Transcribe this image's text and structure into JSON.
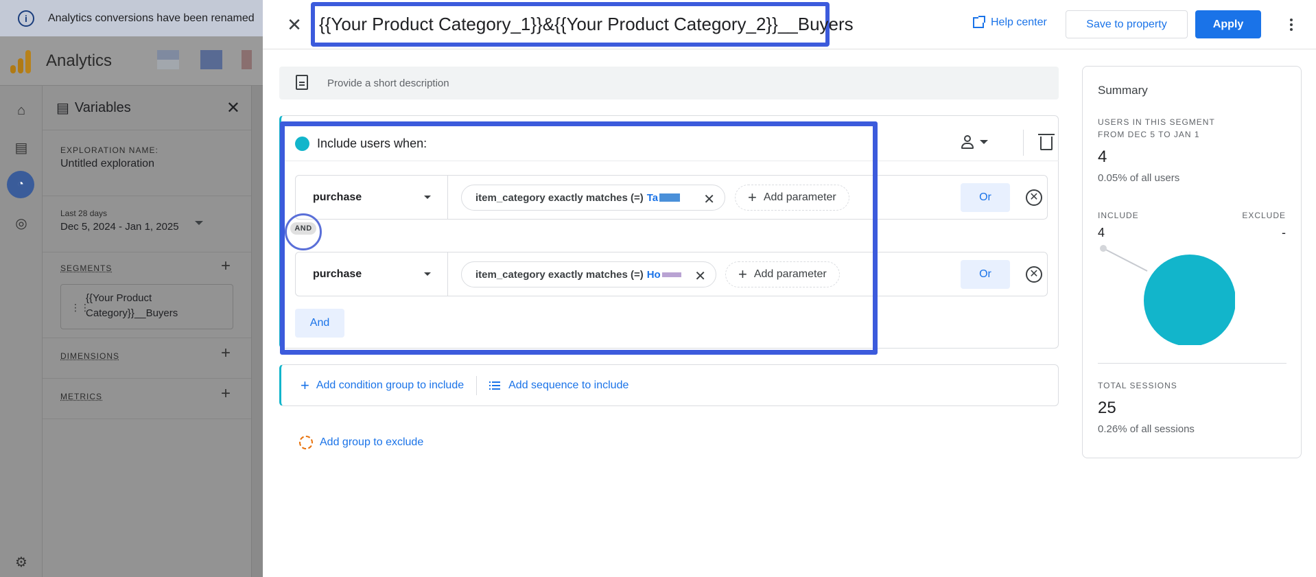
{
  "banner": {
    "text": "Analytics conversions have been renamed"
  },
  "app": {
    "name": "Analytics"
  },
  "variables": {
    "title": "Variables",
    "exploration_label": "EXPLORATION NAME:",
    "exploration_name": "Untitled exploration",
    "date_label": "Last 28 days",
    "date_range": "Dec 5, 2024 - Jan 1, 2025",
    "segments_label": "SEGMENTS",
    "segment_name": "{{Your Product Category}}__Buyers",
    "dimensions_label": "DIMENSIONS",
    "metrics_label": "METRICS"
  },
  "dialog": {
    "title": "{{Your Product Category_1}}&{{Your Product Category_2}}__Buyers",
    "help_label": "Help center",
    "save_label": "Save to property",
    "apply_label": "Apply",
    "description_placeholder": "Provide a short description",
    "include_label": "Include users when:",
    "and_badge": "AND",
    "and_button": "And",
    "add_condition_group": "Add condition group to include",
    "add_sequence": "Add sequence to include",
    "add_exclude": "Add group to exclude",
    "conditions": [
      {
        "event": "purchase",
        "filter": "item_category exactly matches (=)",
        "value": "Ta",
        "add_param": "Add parameter",
        "or_label": "Or"
      },
      {
        "event": "purchase",
        "filter": "item_category exactly matches (=)",
        "value": "Ho",
        "add_param": "Add parameter",
        "or_label": "Or"
      }
    ]
  },
  "summary": {
    "title": "Summary",
    "users_label_1": "USERS IN THIS SEGMENT",
    "users_label_2": "FROM DEC 5 TO JAN 1",
    "users_value": "4",
    "users_pct": "0.05% of all users",
    "include_label": "INCLUDE",
    "exclude_label": "EXCLUDE",
    "include_value": "4",
    "exclude_value": "-",
    "sessions_label": "TOTAL SESSIONS",
    "sessions_value": "25",
    "sessions_pct": "0.26% of all sessions",
    "pie_color": "#12b5cb"
  },
  "colors": {
    "accent": "#1a73e8",
    "highlight": "#3c5bdc",
    "teal": "#12b5cb"
  }
}
